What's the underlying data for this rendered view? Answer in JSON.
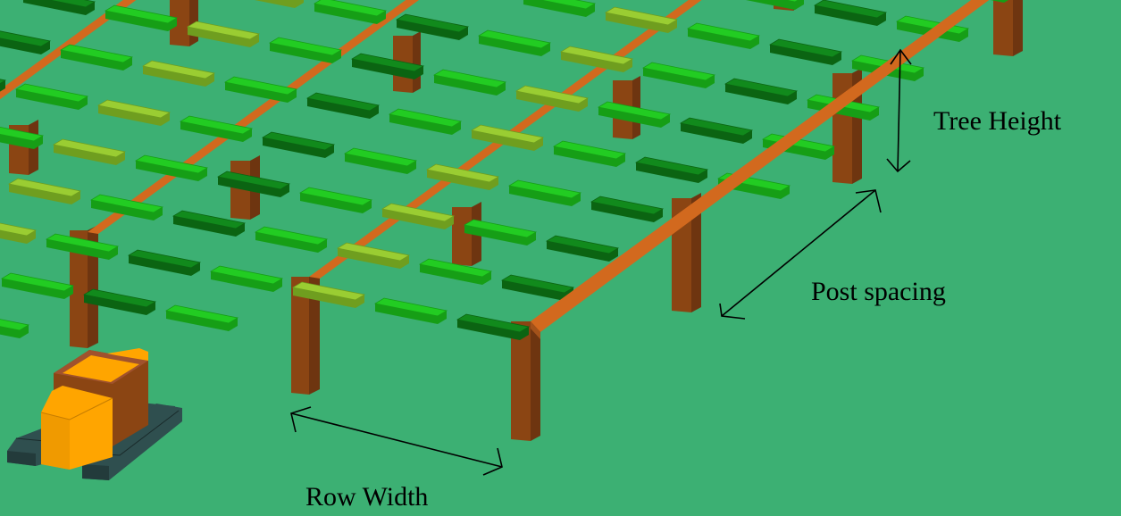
{
  "diagram": {
    "labels": {
      "tree_height": "Tree Height",
      "post_spacing": "Post spacing",
      "row_width": "Row Width"
    },
    "colors": {
      "background": "#3cb073",
      "beam": "#d2691e",
      "beam_dark": "#a3521a",
      "post": "#8b4513",
      "post_dark": "#6e3510",
      "leaf_light": "#9acd32",
      "leaf_mid": "#22cc22",
      "leaf_dark": "#118a1c",
      "vehicle_body": "#ffa500",
      "vehicle_frame": "#8b4513",
      "vehicle_tracks": "#2f4f4f",
      "arrow": "#000000"
    }
  }
}
